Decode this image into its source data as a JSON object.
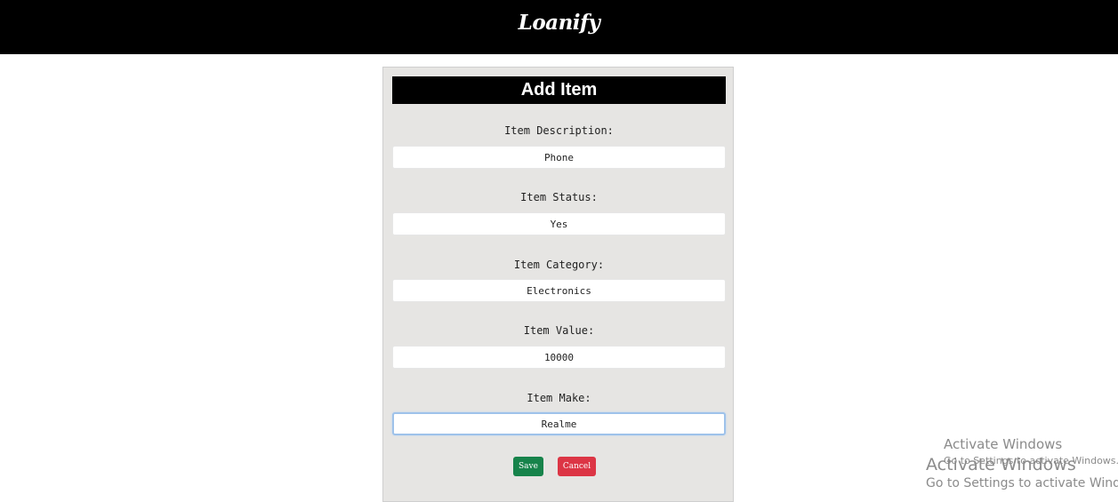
{
  "navbar": {
    "brand": "Loanify"
  },
  "form": {
    "title": "Add Item",
    "fields": [
      {
        "label": "Item Description:",
        "value": "Phone"
      },
      {
        "label": "Item Status:",
        "value": "Yes"
      },
      {
        "label": "Item Category:",
        "value": "Electronics"
      },
      {
        "label": "Item Value:",
        "value": "10000"
      },
      {
        "label": "Item Make:",
        "value": "Realme"
      }
    ],
    "save_label": "Save",
    "cancel_label": "Cancel"
  },
  "watermark": {
    "line1": "Activate Windows",
    "line2": "Go to Settings to activate Windows.",
    "line3": "Activate Windows",
    "line4": "Go to Settings to activate Windo"
  },
  "colors": {
    "navbar_bg": "#000000",
    "card_bg": "#e6e5e3",
    "save_button": "#17834b",
    "cancel_button": "#dc3545",
    "focus_ring": "#9ec2ea"
  }
}
